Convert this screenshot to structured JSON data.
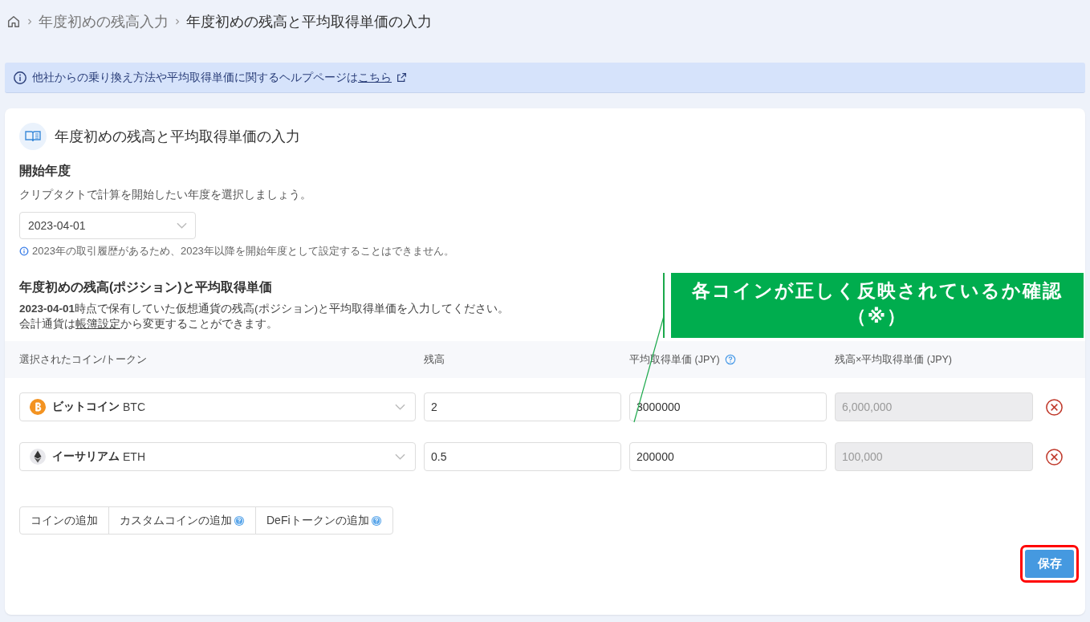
{
  "breadcrumb": [
    {
      "label": "年度初めの残高入力",
      "current": false
    },
    {
      "label": "年度初めの残高と平均取得単価の入力",
      "current": true
    }
  ],
  "alert": {
    "text": "他社からの乗り換え方法や平均取得単価に関するヘルプページは",
    "link": "こちら"
  },
  "card": {
    "title": "年度初めの残高と平均取得単価の入力",
    "start_year": {
      "heading": "開始年度",
      "description": "クリプタクトで計算を開始したい年度を選択しましょう。",
      "value": "2023-04-01",
      "note": "2023年の取引履歴があるため、2023年以降を開始年度として設定することはできません。"
    },
    "balances": {
      "heading": "年度初めの残高(ポジション)と平均取得単価",
      "description": "**2023-04-01**時点で保有していた仮想通貨の残高(ポジション)と平均取得単価を入力してください。",
      "note_before": "会計通貨は",
      "note_link": "帳簿設定",
      "note_after": "から変更することができます。"
    },
    "table": {
      "columns": [
        {
          "label": "選択されたコイン/トークン",
          "help": false
        },
        {
          "label": "残高",
          "help": false
        },
        {
          "label": "平均取得単価 (JPY)",
          "help": true
        },
        {
          "label": "残高×平均取得単価 (JPY)",
          "help": false
        }
      ],
      "rows": [
        {
          "kind": "btc",
          "name": "ビットコイン",
          "symbol": "BTC",
          "balance": "2",
          "price": "3000000",
          "total": "6,000,000",
          "total_disabled": true
        },
        {
          "kind": "eth",
          "name": "イーサリアム",
          "symbol": "ETH",
          "balance": "0.5",
          "price": "200000",
          "total": "100,000",
          "total_disabled": true
        }
      ]
    },
    "add_buttons": [
      {
        "label": "コインの追加",
        "help": false
      },
      {
        "label": "カスタムコインの追加",
        "help": true
      },
      {
        "label": "DeFiトークンの追加",
        "help": true
      }
    ],
    "save": {
      "label": "保存",
      "highlighted": true
    }
  },
  "annotation": {
    "text": "各コインが正しく反映されているか確認（※）"
  }
}
